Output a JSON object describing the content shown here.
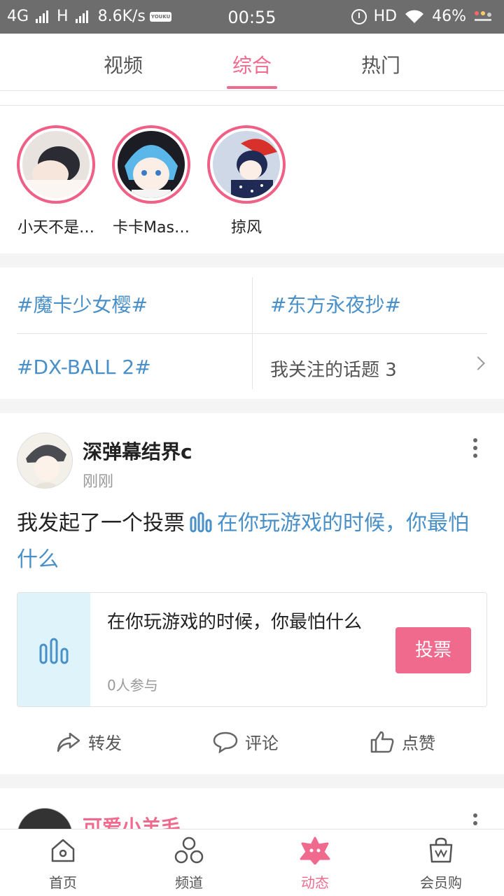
{
  "status": {
    "net1": "4G",
    "net2": "H",
    "speed": "8.6K/s",
    "app_badge": "YOUKU",
    "time": "00:55",
    "hd": "HD",
    "battery": "46%"
  },
  "tabs": [
    {
      "label": "视频"
    },
    {
      "label": "综合"
    },
    {
      "label": "热门"
    }
  ],
  "following": [
    {
      "name": "小天不是…"
    },
    {
      "name": "卡卡Mas…"
    },
    {
      "name": "掠风"
    }
  ],
  "topics": [
    {
      "label": "#魔卡少女樱#"
    },
    {
      "label": "#东方永夜抄#"
    },
    {
      "label": "#DX-BALL 2#"
    }
  ],
  "followed_topics": "我关注的话题 3",
  "post": {
    "user": "深弹幕结界c",
    "time": "刚刚",
    "text_prefix": "我发起了一个投票",
    "text_link": "在你玩游戏的时候，你最怕什么",
    "vote": {
      "title": "在你玩游戏的时候，你最怕什么",
      "participants": "0人参与",
      "button": "投票"
    },
    "actions": {
      "share": "转发",
      "comment": "评论",
      "like": "点赞"
    }
  },
  "next_post": {
    "user": "可爱小羊毛"
  },
  "bottom_nav": [
    {
      "label": "首页",
      "icon": "home-icon"
    },
    {
      "label": "频道",
      "icon": "channels-icon"
    },
    {
      "label": "动态",
      "icon": "feed-icon"
    },
    {
      "label": "会员购",
      "icon": "shopping-bag-icon"
    }
  ],
  "colors": {
    "accent": "#f06a8e",
    "link": "#4a90c8",
    "vote_panel": "#dff3fb"
  }
}
